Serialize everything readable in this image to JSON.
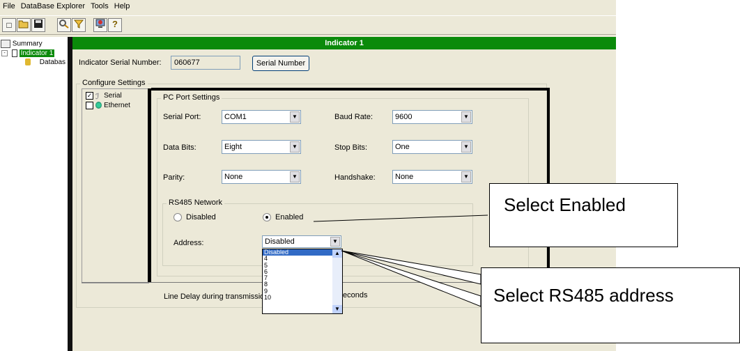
{
  "menu": [
    "File",
    "DataBase Explorer",
    "Tools",
    "Help"
  ],
  "toolbar_icons": [
    "new-document-icon",
    "open-folder-icon",
    "save-disk-icon",
    "search-icon",
    "filter-icon",
    "monitor-icon",
    "help-icon"
  ],
  "tree": {
    "summary": "Summary",
    "indicator": "Indicator 1",
    "database": "Databas"
  },
  "panel": {
    "title": "Indicator 1",
    "serial_label": "Indicator Serial Number:",
    "serial_value": "060677",
    "serial_button": "Serial Number",
    "configure_legend": "Configure Settings",
    "options": [
      {
        "label": "Serial",
        "checked": true
      },
      {
        "label": "Ethernet",
        "checked": false
      }
    ]
  },
  "pc_port": {
    "legend": "PC Port Settings",
    "serial_port_label": "Serial Port:",
    "serial_port_value": "COM1",
    "baud_rate_label": "Baud Rate:",
    "baud_rate_value": "9600",
    "data_bits_label": "Data Bits:",
    "data_bits_value": "Eight",
    "stop_bits_label": "Stop Bits:",
    "stop_bits_value": "One",
    "parity_label": "Parity:",
    "parity_value": "None",
    "handshake_label": "Handshake:",
    "handshake_value": "None"
  },
  "rs485": {
    "legend": "RS485 Network",
    "disabled_label": "Disabled",
    "enabled_label": "Enabled",
    "selected": "Enabled",
    "address_label": "Address:",
    "address_value": "Disabled",
    "address_options": [
      "Disabled",
      "4",
      "5",
      "6",
      "7",
      "8",
      "9",
      "10"
    ],
    "address_selected": "Disabled"
  },
  "line_delay": {
    "label": "Line Delay during transmission:",
    "units_partial": "econds"
  },
  "callouts": {
    "enabled": "Select Enabled",
    "address": "Select RS485 address"
  },
  "colors": {
    "title_bar": "#0a8a0a",
    "selection": "#316ac5",
    "window_bg": "#ece9d8"
  }
}
